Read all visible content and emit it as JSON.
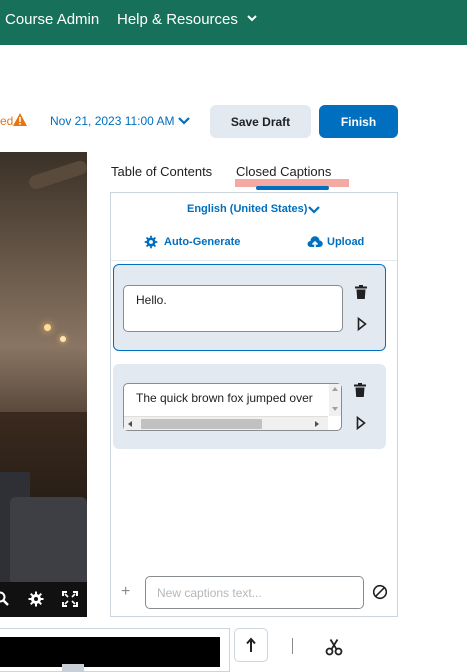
{
  "topnav": {
    "items": [
      {
        "label": "Course Admin",
        "has_dropdown": false
      },
      {
        "label": "Help & Resources",
        "has_dropdown": true
      }
    ],
    "bg_color": "#17715a"
  },
  "toolbar": {
    "status_prefix": "ed",
    "warning_icon": "warning-icon",
    "date_label": "Nov 21, 2023 11:00 AM",
    "save_draft_label": "Save Draft",
    "finish_label": "Finish"
  },
  "video": {
    "controls": [
      "search-icon",
      "gear-icon",
      "fullscreen-icon"
    ]
  },
  "tabs": [
    {
      "label": "Table of Contents",
      "active": false
    },
    {
      "label": "Closed Captions",
      "active": true
    }
  ],
  "captions": {
    "language_label": "English (United States)",
    "auto_generate_label": "Auto-Generate",
    "upload_label": "Upload",
    "items": [
      {
        "text": "Hello.",
        "selected": true
      },
      {
        "text": "The quick brown fox jumped over",
        "selected": false
      }
    ],
    "new_caption_placeholder": "New captions text..."
  },
  "colors": {
    "accent": "#006fbf",
    "warning": "#e87511",
    "card_bg": "#e3e9f1"
  }
}
